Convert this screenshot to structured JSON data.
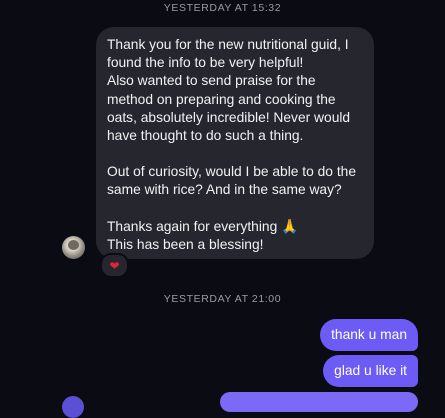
{
  "conversation": {
    "timestamps": [
      "YESTERDAY AT 15:32",
      "YESTERDAY AT 21:00"
    ],
    "incoming_message": {
      "paragraphs": [
        "Thank you for the new nutritional guid, I\nfound the info to be very helpful!\nAlso wanted to send praise for the\nmethod on preparing and cooking the\noats, absolutely incredible! Never would\nhave thought to do such a thing.",
        "Out of curiosity, would I be able to do the\nsame with rice? And in the same way?",
        "Thanks again for everything 🙏\nThis has been a blessing!"
      ],
      "reaction": "❤"
    },
    "outgoing_messages": [
      "thank u man",
      "glad u like it"
    ]
  },
  "colors": {
    "background": "#0b0b14",
    "incoming_bubble": "#26262e",
    "outgoing_bubble": "#6c5bf5",
    "reaction_heart": "#e0263d",
    "timestamp_text": "#9a9aa6"
  },
  "icons": {
    "reaction": "heart-icon",
    "avatar": "user-avatar"
  }
}
